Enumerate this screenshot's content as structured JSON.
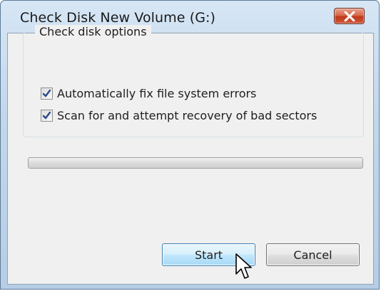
{
  "window": {
    "title": "Check Disk New Volume (G:)",
    "close_icon": "close-x-icon"
  },
  "options": {
    "group_label": "Check disk options",
    "items": [
      {
        "label": "Automatically fix file system errors",
        "checked": true
      },
      {
        "label": "Scan for and attempt recovery of bad sectors",
        "checked": true
      }
    ]
  },
  "progress": {
    "percent": 0
  },
  "buttons": {
    "start_label": "Start",
    "cancel_label": "Cancel"
  },
  "cursor": {
    "icon": "arrow-pointer-icon"
  },
  "colors": {
    "titlebar": "#c3d7ec",
    "close_button": "#c0391b",
    "checkmark": "#2a4a8a",
    "start_button_border": "#3c7fb1"
  }
}
